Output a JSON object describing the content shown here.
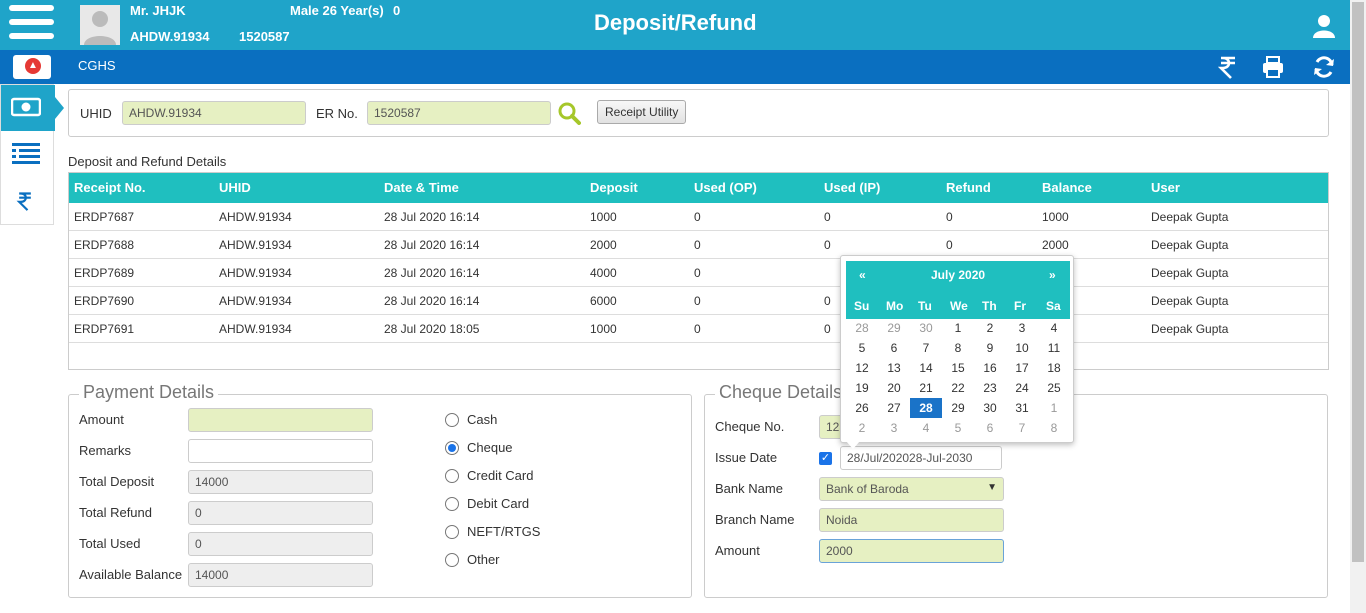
{
  "header": {
    "patient_name": "Mr. JHJK",
    "patient_info": "Male 26 Year(s)",
    "zero": "0",
    "uhid": "AHDW.91934",
    "er_no": "1520587",
    "title": "Deposit/Refund"
  },
  "subbar": {
    "org": "CGHS"
  },
  "search": {
    "uhid_label": "UHID",
    "uhid_value": "AHDW.91934",
    "er_label": "ER No.",
    "er_value": "1520587",
    "receipt_button": "Receipt Utility"
  },
  "grid": {
    "caption": "Deposit and Refund Details",
    "columns": [
      "Receipt No.",
      "UHID",
      "Date & Time",
      "Deposit",
      "Used (OP)",
      "Used (IP)",
      "Refund",
      "Balance",
      "User"
    ],
    "rows": [
      [
        "ERDP7687",
        "AHDW.91934",
        "28 Jul 2020 16:14",
        "1000",
        "0",
        "0",
        "0",
        "1000",
        "Deepak Gupta"
      ],
      [
        "ERDP7688",
        "AHDW.91934",
        "28 Jul 2020 16:14",
        "2000",
        "0",
        "0",
        "0",
        "2000",
        "Deepak Gupta"
      ],
      [
        "ERDP7689",
        "AHDW.91934",
        "28 Jul 2020 16:14",
        "4000",
        "0",
        "",
        "",
        "",
        "Deepak Gupta"
      ],
      [
        "ERDP7690",
        "AHDW.91934",
        "28 Jul 2020 16:14",
        "6000",
        "0",
        "0",
        "",
        "",
        "Deepak Gupta"
      ],
      [
        "ERDP7691",
        "AHDW.91934",
        "28 Jul 2020 18:05",
        "1000",
        "0",
        "0",
        "",
        "",
        "Deepak Gupta"
      ]
    ]
  },
  "payment": {
    "legend": "Payment Details",
    "amount_label": "Amount",
    "amount_value": "",
    "remarks_label": "Remarks",
    "remarks_value": "",
    "total_deposit_label": "Total Deposit",
    "total_deposit_value": "14000",
    "total_refund_label": "Total Refund",
    "total_refund_value": "0",
    "total_used_label": "Total Used",
    "total_used_value": "0",
    "available_label": "Available Balance",
    "available_value": "14000",
    "modes": [
      "Cash",
      "Cheque",
      "Credit Card",
      "Debit Card",
      "NEFT/RTGS",
      "Other"
    ],
    "selected_mode": "Cheque"
  },
  "cheque": {
    "legend": "Cheque Details",
    "cheque_no_label": "Cheque No.",
    "cheque_no_value": "123",
    "issue_date_label": "Issue Date",
    "issue_date_value": "28/Jul/202028-Jul-2030",
    "bank_label": "Bank Name",
    "bank_value": "Bank of Baroda",
    "branch_label": "Branch Name",
    "branch_value": "Noida",
    "amount_label": "Amount",
    "amount_value": "2000"
  },
  "calendar": {
    "prev": "«",
    "next": "»",
    "month": "July 2020",
    "weekdays": [
      "Su",
      "Mo",
      "Tu",
      "We",
      "Th",
      "Fr",
      "Sa"
    ],
    "weeks": [
      [
        "28",
        "29",
        "30",
        "1",
        "2",
        "3",
        "4"
      ],
      [
        "5",
        "6",
        "7",
        "8",
        "9",
        "10",
        "11"
      ],
      [
        "12",
        "13",
        "14",
        "15",
        "16",
        "17",
        "18"
      ],
      [
        "19",
        "20",
        "21",
        "22",
        "23",
        "24",
        "25"
      ],
      [
        "26",
        "27",
        "28",
        "29",
        "30",
        "31",
        "1"
      ],
      [
        "2",
        "3",
        "4",
        "5",
        "6",
        "7",
        "8"
      ]
    ],
    "selected": "28"
  },
  "colors": {
    "primary": "#1fa4c9",
    "subbar": "#0a6fc0",
    "grid_header": "#1fbfbf",
    "input_green": "#e6f0c2"
  }
}
